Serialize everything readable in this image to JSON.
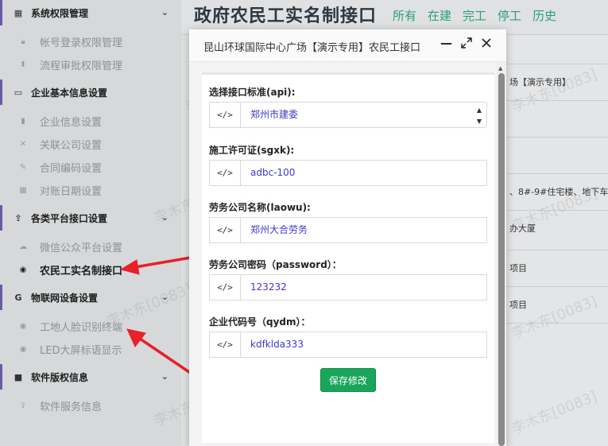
{
  "sidebar": {
    "sections": [
      {
        "label": "系统权限管理",
        "icon": "table-icon",
        "items": [
          {
            "label": "帐号登录权限管理",
            "icon": "lock-icon"
          },
          {
            "label": "流程审批权限管理",
            "icon": "sort-icon"
          }
        ]
      },
      {
        "label": "企业基本信息设置",
        "icon": "id-card-icon",
        "items": [
          {
            "label": "企业信息设置",
            "icon": "building-icon"
          },
          {
            "label": "关联公司设置",
            "icon": "tools-icon"
          },
          {
            "label": "合同编码设置",
            "icon": "edit-icon"
          },
          {
            "label": "对账日期设置",
            "icon": "calendar-icon"
          }
        ]
      },
      {
        "label": "各类平台接口设置",
        "icon": "upload-icon",
        "items": [
          {
            "label": "微信公众平台设置",
            "icon": "wechat-icon"
          },
          {
            "label": "农民工实名制接口",
            "icon": "user-circle-icon"
          }
        ]
      },
      {
        "label": "物联网设备设置",
        "icon": "google-icon",
        "items": [
          {
            "label": "工地人脸识别终端",
            "icon": "user-circle-icon"
          },
          {
            "label": "LED大屏标语显示",
            "icon": "user-circle-icon"
          }
        ]
      },
      {
        "label": "软件版权信息",
        "icon": "registered-icon",
        "items": [
          {
            "label": "软件服务信息",
            "icon": "upload-icon"
          }
        ]
      }
    ]
  },
  "header": {
    "title": "政府农民工实名制接口",
    "tabs": [
      "所有",
      "在建",
      "完工",
      "停工",
      "历史"
    ]
  },
  "background_rows": [
    "场【演示专用】",
    "",
    "",
    "、8#-9#住宅楼、地下车",
    "办大厦",
    "项目",
    "项目",
    ""
  ],
  "watermark": "李木东[0083]",
  "modal": {
    "title": "昆山环球国际中心广场【演示专用】农民工接口",
    "fields": [
      {
        "label": "选择接口标准(api):",
        "addon": "</>",
        "value": "郑州市建委",
        "type": "select"
      },
      {
        "label": "施工许可证(sgxk):",
        "addon": "</>",
        "value": "adbc-100",
        "type": "text"
      },
      {
        "label": "劳务公司名称(laowu):",
        "addon": "</>",
        "value": "郑州大合劳务",
        "type": "text"
      },
      {
        "label": "劳务公司密码（password）：",
        "addon": "</>",
        "value": "123232",
        "type": "text"
      },
      {
        "label": "企业代码号（qydm）：",
        "addon": "</>",
        "value": "kdfklda333",
        "type": "text"
      }
    ],
    "save_label": "保存修改"
  },
  "colors": {
    "accent_green": "#19a55a",
    "tab_green": "#2a9f77",
    "arrow_red": "#e8202a",
    "section_bar": "#6a5aa8"
  }
}
